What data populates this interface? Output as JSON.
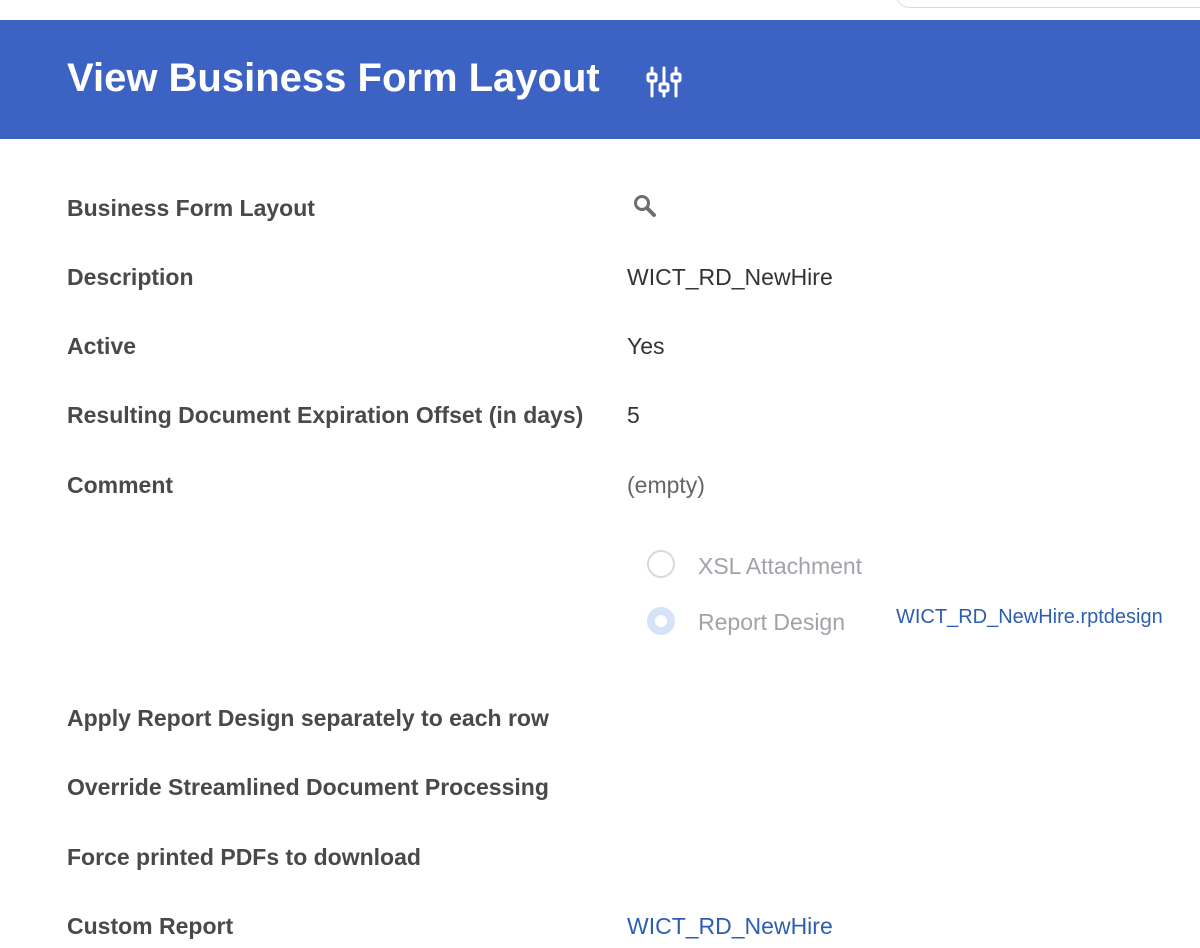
{
  "header": {
    "title": "View Business Form Layout",
    "related_actions_icon": "sliders-icon"
  },
  "fields": {
    "business_form_layout": {
      "label": "Business Form Layout",
      "icon": "search-icon"
    },
    "description": {
      "label": "Description",
      "value": "WICT_RD_NewHire"
    },
    "active": {
      "label": "Active",
      "value": "Yes"
    },
    "expiration_offset": {
      "label": "Resulting Document Expiration Offset (in days)",
      "value": "5"
    },
    "comment": {
      "label": "Comment",
      "value": "(empty)"
    },
    "layout_type": {
      "options": [
        {
          "label": "XSL Attachment",
          "selected": false
        },
        {
          "label": "Report Design",
          "selected": true
        }
      ],
      "report_design_file": "WICT_RD_NewHire.rptdesign"
    },
    "apply_separately": {
      "label": "Apply Report Design separately to each row"
    },
    "override_streamlined": {
      "label": "Override Streamlined Document Processing"
    },
    "force_pdf_download": {
      "label": "Force printed PDFs to download"
    },
    "custom_report": {
      "label": "Custom Report",
      "value": "WICT_RD_NewHire"
    }
  },
  "colors": {
    "header_bg": "#3c63c3",
    "link": "#2d5fb0",
    "label_text": "#494949",
    "disabled_text": "#a0a3a8"
  }
}
